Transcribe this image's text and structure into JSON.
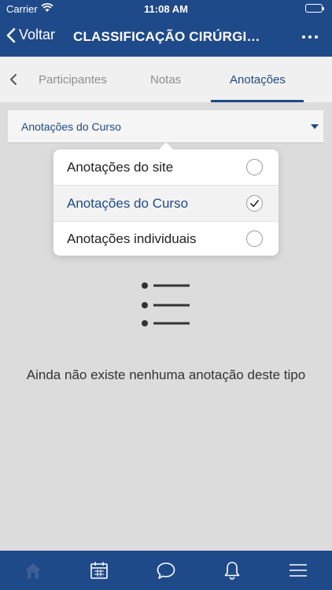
{
  "status_bar": {
    "carrier": "Carrier",
    "time": "11:08 AM"
  },
  "nav": {
    "back_label": "Voltar",
    "title": "CLASSIFICAÇÃO CIRÚRGIC..."
  },
  "tabs": [
    {
      "label": "Participantes",
      "active": false
    },
    {
      "label": "Notas",
      "active": false
    },
    {
      "label": "Anotações",
      "active": true
    }
  ],
  "filter": {
    "selected": "Anotações do Curso"
  },
  "dropdown": {
    "options": [
      {
        "label": "Anotações do site",
        "selected": false
      },
      {
        "label": "Anotações do Curso",
        "selected": true
      },
      {
        "label": "Anotações individuais",
        "selected": false
      }
    ]
  },
  "empty": {
    "message": "Ainda não existe nenhuma anotação deste tipo",
    "icon": "list-icon"
  },
  "bottom_nav": [
    {
      "icon": "home-icon",
      "active": true
    },
    {
      "icon": "calendar-icon",
      "active": false
    },
    {
      "icon": "chat-icon",
      "active": false
    },
    {
      "icon": "bell-icon",
      "active": false
    },
    {
      "icon": "menu-icon",
      "active": false
    }
  ],
  "colors": {
    "primary": "#1f4a8a",
    "background": "#dcdcdc",
    "tab_inactive": "#8e8e8e"
  }
}
